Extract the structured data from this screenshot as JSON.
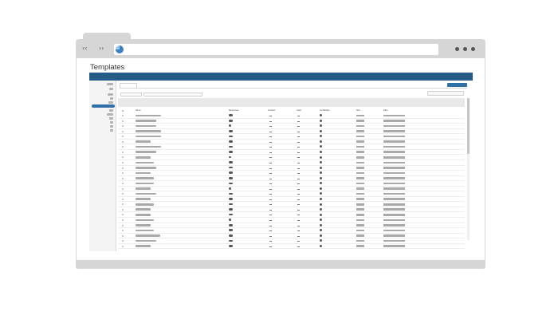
{
  "browser": {
    "back_label": "‹‹",
    "forward_label": "››",
    "menu_icon": "more-dots-icon",
    "site_icon": "pie-logo-icon"
  },
  "page": {
    "title": "Templates"
  },
  "table": {
    "columns": [
      "Name",
      "Responses",
      "Created",
      "Used",
      "Certificates",
      "Size",
      "Date"
    ],
    "rows": [
      {
        "name_len": 0.95
      },
      {
        "name_len": 0.77
      },
      {
        "name_len": 0.77
      },
      {
        "name_len": 0.95
      },
      {
        "name_len": 0.95
      },
      {
        "name_len": 0.55
      },
      {
        "name_len": 0.95
      },
      {
        "name_len": 0.77
      },
      {
        "name_len": 0.55
      },
      {
        "name_len": 0.68
      },
      {
        "name_len": 0.77
      },
      {
        "name_len": 0.55
      },
      {
        "name_len": 0.68
      },
      {
        "name_len": 0.68
      },
      {
        "name_len": 0.55
      },
      {
        "name_len": 0.77
      },
      {
        "name_len": 0.55
      },
      {
        "name_len": 0.68
      },
      {
        "name_len": 0.55
      },
      {
        "name_len": 0.55
      },
      {
        "name_len": 0.68
      },
      {
        "name_len": 0.55
      },
      {
        "name_len": 0.68
      },
      {
        "name_len": 0.9
      },
      {
        "name_len": 0.77
      },
      {
        "name_len": 0.55
      }
    ]
  },
  "colors": {
    "header": "#275b87",
    "accent": "#2f6fa8"
  }
}
